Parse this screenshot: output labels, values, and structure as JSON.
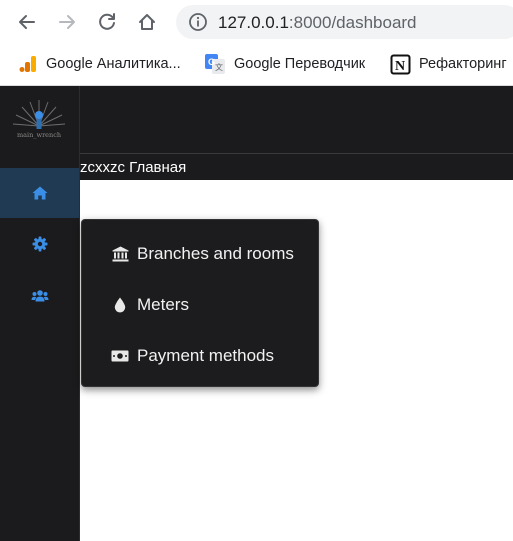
{
  "browser": {
    "url_host": "127.0.0.1",
    "url_path": ":8000/dashboard",
    "bookmarks": [
      {
        "label": "Google Аналитика...",
        "icon": "analytics-icon"
      },
      {
        "label": "Google Переводчик",
        "icon": "translate-icon"
      },
      {
        "label": "Рефакторинг",
        "icon": "notion-icon"
      }
    ]
  },
  "app": {
    "logo_text": "main_wrench",
    "breadcrumb": "zcxxzc Главная",
    "sidebar": {
      "items": [
        {
          "icon": "home-icon",
          "active": true
        },
        {
          "icon": "gear-icon",
          "active": false
        },
        {
          "icon": "users-icon",
          "active": false
        }
      ]
    },
    "menu": {
      "items": [
        {
          "label": "Branches and rooms",
          "icon": "bank-icon"
        },
        {
          "label": "Meters",
          "icon": "drop-icon"
        },
        {
          "label": "Payment methods",
          "icon": "money-icon"
        }
      ]
    }
  },
  "colors": {
    "accent": "#3a8ee6",
    "sidebar_bg": "#1b1b1d",
    "active_bg": "#1f3a52"
  }
}
